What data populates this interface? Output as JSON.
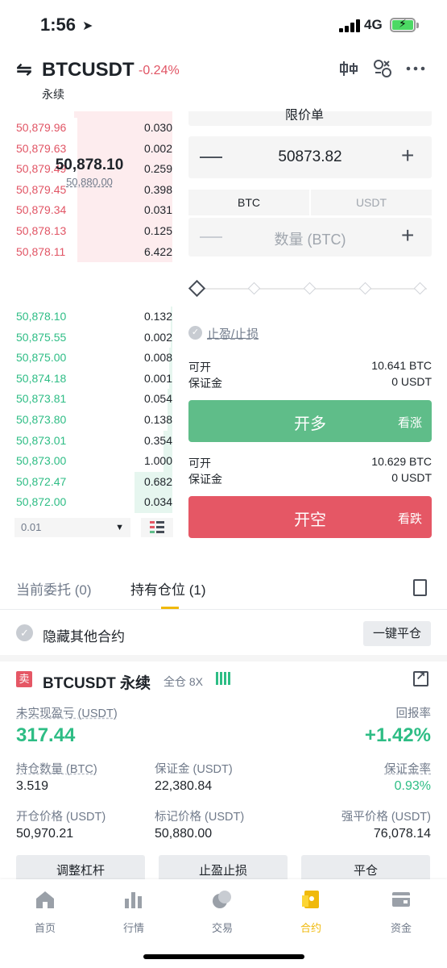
{
  "status": {
    "time": "1:56",
    "network": "4G"
  },
  "header": {
    "symbol": "BTCUSDT",
    "change": "-0.24%",
    "subtitle": "永续"
  },
  "orderbook": {
    "asks": [
      {
        "price": "50,879.96",
        "qty": "0.030",
        "depth": 0.55
      },
      {
        "price": "50,879.63",
        "qty": "0.002",
        "depth": 0.55
      },
      {
        "price": "50,879.49",
        "qty": "0.259",
        "depth": 0.55
      },
      {
        "price": "50,879.45",
        "qty": "0.398",
        "depth": 0.55
      },
      {
        "price": "50,879.34",
        "qty": "0.031",
        "depth": 0.55
      },
      {
        "price": "50,878.13",
        "qty": "0.125",
        "depth": 0.55
      },
      {
        "price": "50,878.11",
        "qty": "6.422",
        "depth": 0.55
      }
    ],
    "last_price": "50,878.10",
    "mark_price": "50,880.00",
    "bids": [
      {
        "price": "50,878.10",
        "qty": "0.132",
        "depth": 0.01
      },
      {
        "price": "50,875.55",
        "qty": "0.002",
        "depth": 0.01
      },
      {
        "price": "50,875.00",
        "qty": "0.008",
        "depth": 0.02
      },
      {
        "price": "50,874.18",
        "qty": "0.001",
        "depth": 0.02
      },
      {
        "price": "50,873.81",
        "qty": "0.054",
        "depth": 0.03
      },
      {
        "price": "50,873.80",
        "qty": "0.138",
        "depth": 0.03
      },
      {
        "price": "50,873.01",
        "qty": "0.354",
        "depth": 0.05
      },
      {
        "price": "50,873.00",
        "qty": "1.000",
        "depth": 0.05
      },
      {
        "price": "50,872.47",
        "qty": "0.682",
        "depth": 0.22
      },
      {
        "price": "50,872.00",
        "qty": "0.034",
        "depth": 0.22
      }
    ],
    "depth_value": "0.01"
  },
  "form": {
    "order_type": "限价单",
    "price": "50873.82",
    "unit_tabs": [
      "BTC",
      "USDT"
    ],
    "qty_placeholder": "数量 (BTC)",
    "tpsl_label": "止盈/止损",
    "long": {
      "avail_label": "可开",
      "avail_value": "10.641 BTC",
      "margin_label": "保证金",
      "margin_value": "0 USDT",
      "button": "开多",
      "sub": "看涨"
    },
    "short": {
      "avail_label": "可开",
      "avail_value": "10.629 BTC",
      "margin_label": "保证金",
      "margin_value": "0 USDT",
      "button": "开空",
      "sub": "看跌"
    }
  },
  "tabs": {
    "open_orders": "当前委托 (0)",
    "positions": "持有仓位 (1)"
  },
  "hide_other": "隐藏其他合约",
  "close_all": "一键平仓",
  "position": {
    "side": "卖",
    "symbol": "BTCUSDT 永续",
    "margin_mode": "全仓 8X",
    "unrealized_label": "未实现盈亏 (USDT)",
    "unrealized_value": "317.44",
    "roe_label": "回报率",
    "roe_value": "+1.42%",
    "size_label": "持仓数量 (BTC)",
    "size_value": "3.519",
    "margin_label": "保证金 (USDT)",
    "margin_value": "22,380.84",
    "margin_ratio_label": "保证金率",
    "margin_ratio_value": "0.93%",
    "entry_label": "开仓价格 (USDT)",
    "entry_value": "50,970.21",
    "mark_label": "标记价格 (USDT)",
    "mark_value": "50,880.00",
    "liq_label": "强平价格 (USDT)",
    "liq_value": "76,078.14",
    "buttons": [
      "调整杠杆",
      "止盈止损",
      "平仓"
    ]
  },
  "nav": [
    "首页",
    "行情",
    "交易",
    "合约",
    "资金"
  ]
}
